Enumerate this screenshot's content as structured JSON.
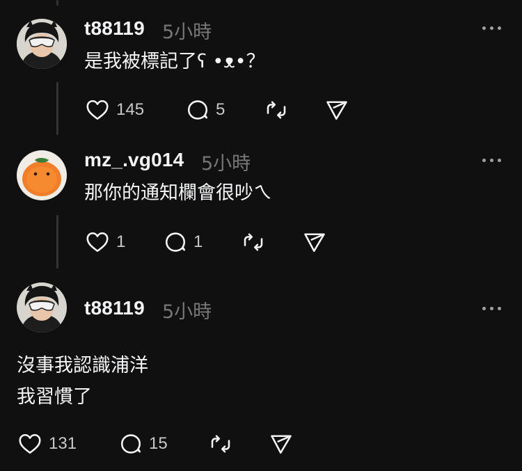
{
  "comments": [
    {
      "username": "t88119",
      "time": "5小時",
      "text": "是我被標記了ʕ •ᴥ•？",
      "likes": "145",
      "replies": "5"
    },
    {
      "username": "mz_.vg014",
      "time": "5小時",
      "text": "那你的通知欄會很吵ㄟ",
      "likes": "1",
      "replies": "1"
    },
    {
      "username": "t88119",
      "time": "5小時",
      "text_lines": [
        "沒事我認識浦洋",
        "我習慣了"
      ],
      "likes": "131",
      "replies": "15"
    }
  ],
  "icons": {
    "like": "heart-icon",
    "reply": "comment-bubble-icon",
    "repost": "repost-icon",
    "share": "send-icon",
    "more": "more-options-icon"
  },
  "colors": {
    "background": "#101010",
    "text": "#f3f5f7",
    "muted": "#777777",
    "thread_line": "#343434"
  }
}
